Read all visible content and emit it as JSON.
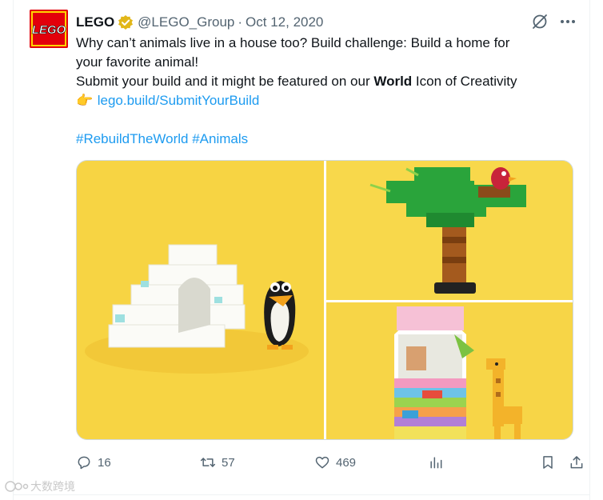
{
  "author": {
    "display_name": "LEGO",
    "handle": "@LEGO_Group",
    "separator": "·",
    "date": "Oct 12, 2020",
    "avatar_text": "LEGO"
  },
  "tweet": {
    "line1": "Why can’t animals live in a house too? Build challenge: Build a home for",
    "line2": "your favorite animal!",
    "line3_before": "Submit your build and it might be featured on our ",
    "line3_bold": "World",
    "line3_after": " Icon of Creativity",
    "pointing_emoji": "👉",
    "link": "lego.build/SubmitYourBuild",
    "hashtag1": "#RebuildTheWorld",
    "hashtag2": "#Animals"
  },
  "actions": {
    "replies": "16",
    "reposts": "57",
    "likes": "469"
  },
  "watermark": "大数跨境",
  "colors": {
    "link": "#1d9bf0",
    "muted": "#536471",
    "lego_red": "#e3000b",
    "verified_gold": "#e2b719"
  }
}
